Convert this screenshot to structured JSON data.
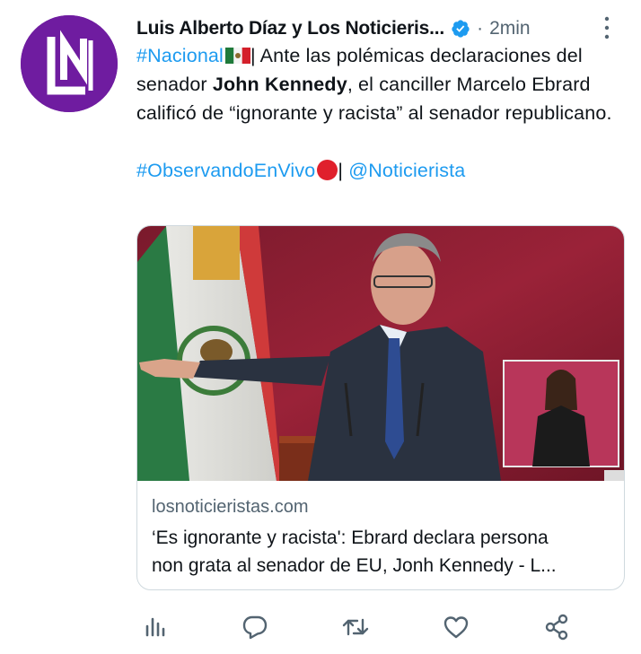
{
  "tweet": {
    "author_name": "Luis Alberto Díaz y Los Noticieris...",
    "separator": "·",
    "time": "2min",
    "text_parts": {
      "hashtag_nacional": "#Nacional",
      "after_flag": "| Ante las polémicas declaraciones del senador ",
      "bold_name": "John Kennedy",
      "rest": ", el canciller Marcelo Ebrard calificó de “ignorante y racista” al senador republicano.",
      "hashtag_observando": "#ObservandoEnVivo",
      "pipe": "| ",
      "mention": "@Noticierista"
    }
  },
  "card": {
    "domain": "losnoticieristas.com",
    "title_line1": "‘Es ignorante y racista': Ebrard declara persona",
    "title_line2": "non grata al senador de EU, Jonh Kennedy - L..."
  },
  "icons": {
    "avatar": "ln-logo-icon",
    "verified": "verified-badge-icon",
    "more": "more-options-icon",
    "views": "analytics-icon",
    "reply": "reply-icon",
    "retweet": "retweet-icon",
    "like": "like-icon",
    "share": "share-icon"
  },
  "colors": {
    "brand_purple": "#6f1ca0",
    "link": "#1d9bf0",
    "secondary_text": "#536471",
    "action_icon": "#536471"
  }
}
